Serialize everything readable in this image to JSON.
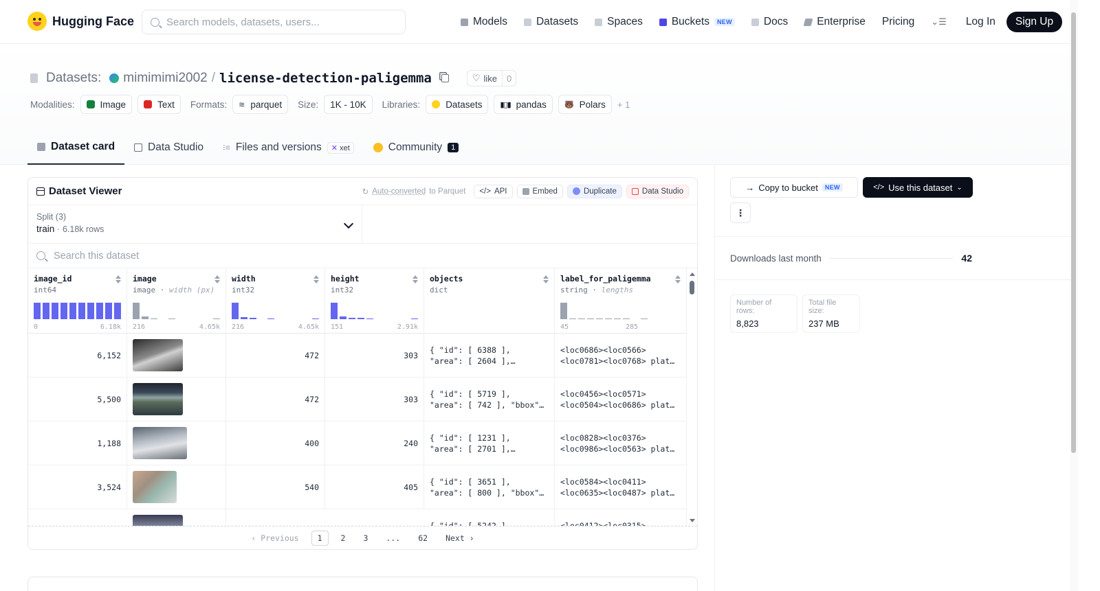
{
  "nav": {
    "brand": "Hugging Face",
    "search_placeholder": "Search models, datasets, users...",
    "links": [
      {
        "label": "Models",
        "icon": "cube-icon",
        "color": "#9ca3af"
      },
      {
        "label": "Datasets",
        "icon": "database-icon",
        "color": "#c9ced6"
      },
      {
        "label": "Spaces",
        "icon": "grid-icon",
        "color": "#c9ced6"
      },
      {
        "label": "Buckets",
        "icon": "bucket-icon",
        "color": "#4f46e5",
        "badge": "NEW"
      },
      {
        "label": "Docs",
        "icon": "book-icon",
        "color": "#c9ced6"
      },
      {
        "label": "Enterprise",
        "icon": "enterprise-icon",
        "color": "#9ca3af"
      },
      {
        "label": "Pricing"
      }
    ],
    "login": "Log In",
    "signup": "Sign Up"
  },
  "header": {
    "section": "Datasets:",
    "user": "mimimimi2002",
    "slash": "/",
    "repo": "license-detection-paligemma",
    "like_label": "like",
    "like_count": "0",
    "modalities_label": "Modalities:",
    "modalities": [
      "Image",
      "Text"
    ],
    "formats_label": "Formats:",
    "format": "parquet",
    "size_label": "Size:",
    "size": "1K - 10K",
    "libraries_label": "Libraries:",
    "libraries": [
      "Datasets",
      "pandas",
      "Polars"
    ],
    "libraries_more": "+ 1"
  },
  "tabs": [
    {
      "label": "Dataset card",
      "active": true
    },
    {
      "label": "Data Studio"
    },
    {
      "label": "Files and versions",
      "badge": "xet"
    },
    {
      "label": "Community",
      "badge": "1"
    }
  ],
  "viewer": {
    "title": "Dataset Viewer",
    "auto_prefix": "Auto-converted",
    "auto_suffix": "to Parquet",
    "api": "API",
    "embed": "Embed",
    "duplicate": "Duplicate",
    "data_studio": "Data Studio",
    "split_label": "Split (3)",
    "split_value": "train",
    "split_rows": "6.18k rows",
    "search_placeholder": "Search this dataset",
    "columns": [
      {
        "name": "image_id",
        "type": "int64",
        "min": "0",
        "max": "6.18k"
      },
      {
        "name": "image",
        "type": "image",
        "type_extra": "width (px)",
        "min": "216",
        "max": "4.65k"
      },
      {
        "name": "width",
        "type": "int32",
        "min": "216",
        "max": "4.65k"
      },
      {
        "name": "height",
        "type": "int32",
        "min": "151",
        "max": "2.91k"
      },
      {
        "name": "objects",
        "type": "dict",
        "min": "",
        "max": ""
      },
      {
        "name": "label_for_paligemma",
        "type": "string",
        "type_extra": "lengths",
        "min": "45",
        "max": "285"
      }
    ],
    "rows": [
      {
        "image_id": "6,152",
        "width": "472",
        "height": "303",
        "objects": "{ \"id\": [ 6388 ],\n\"area\": [ 2604 ],…",
        "label": "<loc0686><loc0566>\n<loc0781><loc0768> plat…"
      },
      {
        "image_id": "5,500",
        "width": "472",
        "height": "303",
        "objects": "{ \"id\": [ 5719 ],\n\"area\": [ 742 ], \"bbox\"…",
        "label": "<loc0456><loc0571>\n<loc0504><loc0686> plat…"
      },
      {
        "image_id": "1,188",
        "width": "400",
        "height": "240",
        "objects": "{ \"id\": [ 1231 ],\n\"area\": [ 2701 ],…",
        "label": "<loc0828><loc0376>\n<loc0986><loc0563> plat…"
      },
      {
        "image_id": "3,524",
        "width": "540",
        "height": "405",
        "objects": "{ \"id\": [ 3651 ],\n\"area\": [ 800 ], \"bbox\"…",
        "label": "<loc0584><loc0411>\n<loc0635><loc0487> plat…"
      },
      {
        "image_id": "",
        "width": "",
        "height": "",
        "objects": "{ \"id\": [ 5242 ],",
        "label": "<loc0412><loc0315>"
      }
    ],
    "pager": {
      "prev": "Previous",
      "pages": [
        "1",
        "2",
        "3",
        "...",
        "62"
      ],
      "next": "Next",
      "current": "1"
    }
  },
  "sidebar": {
    "copy_bucket": "Copy to bucket",
    "copy_bucket_badge": "NEW",
    "use_dataset": "Use this dataset",
    "downloads_label": "Downloads last month",
    "downloads_value": "42",
    "rows_label": "Number of rows:",
    "rows_value": "8,823",
    "size_label": "Total file size:",
    "size_value": "237 MB"
  }
}
